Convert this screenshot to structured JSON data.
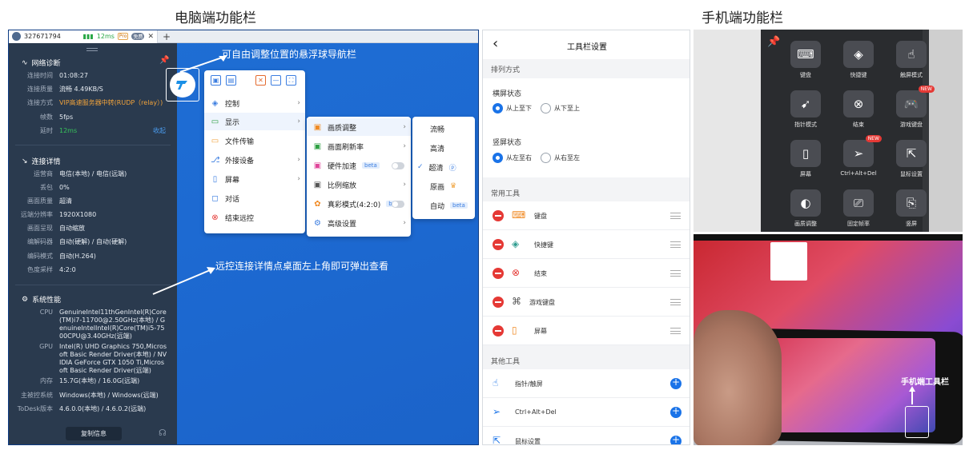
{
  "captions": {
    "desktop": "电脑端功能栏",
    "mobile": "手机端功能栏"
  },
  "tab": {
    "id": "327671794",
    "signal": "12ms",
    "badge": "Pro",
    "badge2": "免费"
  },
  "network": {
    "title": "网络诊断",
    "rows": [
      {
        "k": "连接时间",
        "v": "01:08:27"
      },
      {
        "k": "连接质量",
        "v": "流畅 4.49KB/S"
      },
      {
        "k": "连接方式",
        "v": "VIP高速服务器中转(RUDP（relay）)"
      },
      {
        "k": "帧数",
        "v": "5fps"
      },
      {
        "k": "延时",
        "v": "12ms"
      }
    ],
    "collapse": "收起"
  },
  "details": {
    "title": "连接详情",
    "rows": [
      {
        "k": "运营商",
        "v": "电信(本地) / 电信(远端)"
      },
      {
        "k": "丢包",
        "v": "0%"
      },
      {
        "k": "画面质量",
        "v": "超清"
      },
      {
        "k": "远端分辨率",
        "v": "1920X1080"
      },
      {
        "k": "画面呈现",
        "v": "自动缩放"
      },
      {
        "k": "编解码器",
        "v": "自动(硬解) / 自动(硬解)"
      },
      {
        "k": "编码模式",
        "v": "自动(H.264)"
      },
      {
        "k": "色度采样",
        "v": "4:2:0"
      }
    ]
  },
  "system": {
    "title": "系统性能",
    "cpu_k": "CPU",
    "cpu_v": "GenuineIntel11thGenIntel(R)Core(TM)i7-11700@2.50GHz(本地) / GenuineIntelIntel(R)Core(TM)i5-7500CPU@3.40GHz(远端)",
    "gpu_k": "GPU",
    "gpu_v": "Intel(R) UHD Graphics 750,Microsoft Basic Render Driver(本地) / NVIDIA GeForce GTX 1050 Ti,Microsoft Basic Render Driver(远端)",
    "mem_k": "内存",
    "mem_v": "15.7G(本地) / 16.0G(远端)",
    "os_k": "主被控系统",
    "os_v": "Windows(本地) / Windows(远端)",
    "ver_k": "ToDesk版本",
    "ver_v": "4.6.0.0(本地) / 4.6.0.2(远端)"
  },
  "copy_button": "复制信息",
  "annotations": {
    "float": "可自由调整位置的悬浮球导航栏",
    "detail": "远控连接详情点桌面左上角即可弹出查看"
  },
  "menu1": [
    "控制",
    "显示",
    "文件传输",
    "外接设备",
    "屏幕",
    "对话",
    "结束远控"
  ],
  "menu2": [
    "画质调整",
    "画面刷新率",
    "硬件加速",
    "比例缩放",
    "真彩模式(4:2:0)",
    "高级设置"
  ],
  "menu3": [
    "流畅",
    "高清",
    "超清",
    "原画",
    "自动"
  ],
  "beta": "beta",
  "phone": {
    "title": "工具栏设置",
    "sec_order": "排列方式",
    "landscape": "横屏状态",
    "l_opt1": "从上至下",
    "l_opt2": "从下至上",
    "portrait": "竖屏状态",
    "p_opt1": "从左至右",
    "p_opt2": "从右至左",
    "sec_common": "常用工具",
    "common": [
      "键盘",
      "快捷键",
      "结束",
      "游戏键盘",
      "屏幕"
    ],
    "sec_other": "其他工具",
    "other": [
      "指针/触屏",
      "Ctrl+Alt+Del",
      "鼠标设置"
    ]
  },
  "mobile_tools": [
    {
      "label": "键盘",
      "icon": "⌨"
    },
    {
      "label": "快捷键",
      "icon": "◈"
    },
    {
      "label": "触屏模式",
      "icon": "☝"
    },
    {
      "label": "指针模式",
      "icon": "➹"
    },
    {
      "label": "结束",
      "icon": "⊗"
    },
    {
      "label": "游戏键盘",
      "icon": "🎮"
    },
    {
      "label": "屏幕",
      "icon": "▯"
    },
    {
      "label": "Ctrl+Alt+Del",
      "icon": "➢"
    },
    {
      "label": "鼠标设置",
      "icon": "⇱"
    },
    {
      "label": "画质调整",
      "icon": "◐"
    },
    {
      "label": "固定帧率",
      "icon": "⎚"
    },
    {
      "label": "竖屏",
      "icon": "⎘"
    }
  ],
  "new_tag": "NEW",
  "photo_label": "手机端工具栏"
}
